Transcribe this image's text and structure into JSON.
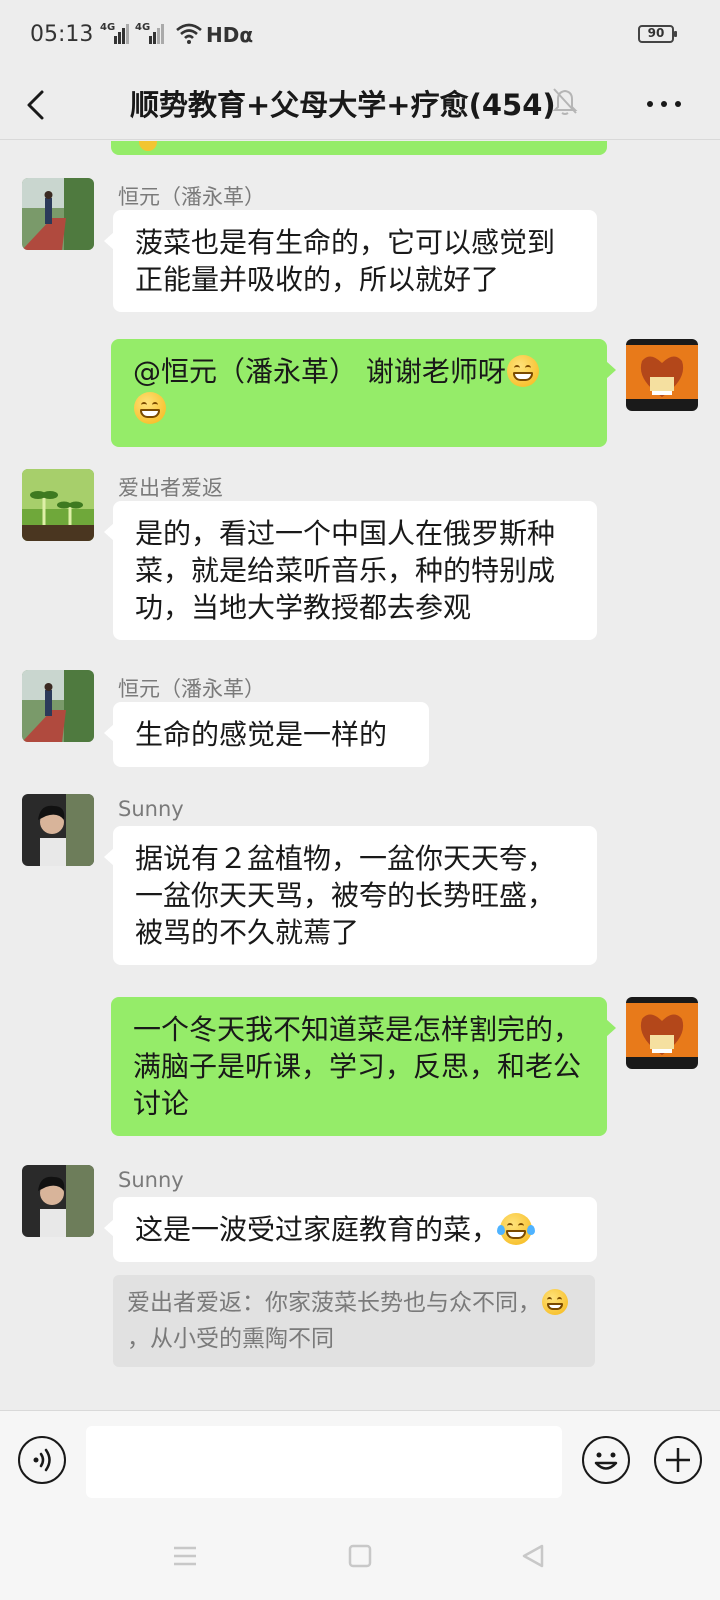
{
  "status_bar": {
    "time": "05:13",
    "network_1": "4G",
    "network_2": "4G",
    "hd_label": "HDα",
    "battery": "90"
  },
  "nav": {
    "title": "顺势教育+父母大学+疗愈(454)",
    "icons": [
      "back-icon",
      "mute-bell-icon",
      "more-icon"
    ]
  },
  "messages": [
    {
      "side": "in",
      "sender": "恒元（潘永革）",
      "text": "菠菜也是有生命的，它可以感觉到正能量并吸收的，所以就好了"
    },
    {
      "side": "out",
      "text": "@恒元（潘永革） 谢谢老师呀",
      "emoji": "grin-emoji"
    },
    {
      "side": "in",
      "sender": "爱出者爱返",
      "text": "是的，看过一个中国人在俄罗斯种菜，就是给菜听音乐，种的特别成功，当地大学教授都去参观"
    },
    {
      "side": "in",
      "sender": "恒元（潘永革）",
      "text": "生命的感觉是一样的"
    },
    {
      "side": "in",
      "sender": "Sunny",
      "text": "据说有２盆植物，一盆你天天夸，一盆你天天骂，被夸的长势旺盛，被骂的不久就蔫了"
    },
    {
      "side": "out",
      "text": "一个冬天我不知道菜是怎样割完的，满脑子是听课，学习，反思，和老公讨论"
    },
    {
      "side": "in",
      "sender": "Sunny",
      "text": "这是一波受过家庭教育的菜，",
      "emoji": "tears-of-joy-emoji"
    }
  ],
  "quote": {
    "prefix": "爱出者爱返：你家菠菜长势也与众不同，",
    "suffix": "，从小受的熏陶不同"
  },
  "input_bar": {
    "placeholder": "",
    "icons": [
      "voice-icon",
      "emoji-icon",
      "plus-icon"
    ]
  },
  "system_nav": {
    "icons": [
      "menu-icon",
      "home-icon",
      "back-triangle-icon"
    ]
  },
  "colors": {
    "background": "#ededed",
    "outgoing_bubble": "#95ec69",
    "incoming_bubble": "#ffffff",
    "quote_bg": "#e1e1e1"
  }
}
